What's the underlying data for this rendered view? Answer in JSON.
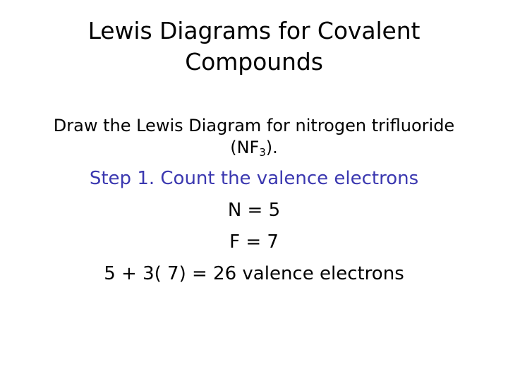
{
  "slide": {
    "background_color": "#FFFFFF",
    "text_color": "#000000",
    "accent_color": "#3B38B0",
    "title": {
      "line1": "Lewis Diagrams for Covalent",
      "line2": "Compounds"
    },
    "body": {
      "prompt_before_subscript": "Draw the Lewis Diagram for nitrogen trifluoride (NF",
      "prompt_subscript": "3",
      "prompt_after_subscript": ").",
      "step_heading": "Step 1. Count the valence electrons",
      "calc_lines": [
        "N = 5",
        "F = 7",
        "5 + 3( 7) = 26 valence electrons"
      ]
    }
  }
}
